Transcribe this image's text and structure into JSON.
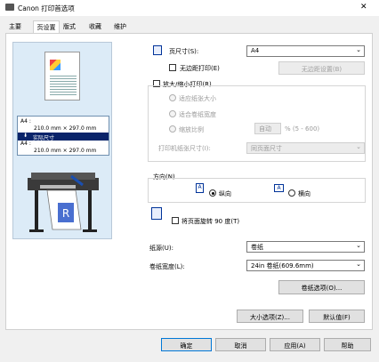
{
  "window": {
    "title": "Canon       打印首选项",
    "close_glyph": "✕"
  },
  "tabs": [
    {
      "label": "主要"
    },
    {
      "label": "页设置"
    },
    {
      "label": "版式"
    },
    {
      "label": "收藏"
    },
    {
      "label": "维护"
    }
  ],
  "preview": {
    "paper_label_a": "A4 :",
    "paper_size_a": "210.0 mm × 297.0 mm",
    "actual_size_label": "实际尺寸",
    "paper_label_b": "A4 :",
    "paper_size_b": "210.0 mm × 297.0 mm",
    "printer_output_letter": "R"
  },
  "page_size": {
    "label": "页尺寸(S):",
    "value": "A4"
  },
  "borderless": {
    "label": "无边距打印(E)",
    "button": "无边距设置(B)"
  },
  "enlarge": {
    "label": "放大/缩小打印(R)",
    "fit_paper": "适应纸张大小",
    "fit_roll": "适合卷纸宽度",
    "scaling": "缩放比例",
    "scaling_value": "自动",
    "scaling_range": "% (5 - 600)",
    "print_paper_size_label": "打印机纸张尺寸(I):",
    "print_paper_size_value": "同页面尺寸"
  },
  "orientation": {
    "label": "方向(N)",
    "portrait": "纵向",
    "landscape": "横向"
  },
  "rotate": {
    "label": "将页面旋转 90 度(T)"
  },
  "paper_source": {
    "label": "纸源(U):",
    "value": "卷纸"
  },
  "roll_width": {
    "label": "卷纸宽度(L):",
    "value": "24in 卷纸(609.6mm)"
  },
  "buttons": {
    "roll_options": "卷纸选项(O)...",
    "size_options": "大小选项(Z)...",
    "defaults": "默认值(F)",
    "ok": "确定",
    "cancel": "取消",
    "apply": "应用(A)",
    "help": "帮助"
  },
  "colors": {
    "accent": "#003399",
    "selected_bar": "#0a246a"
  }
}
